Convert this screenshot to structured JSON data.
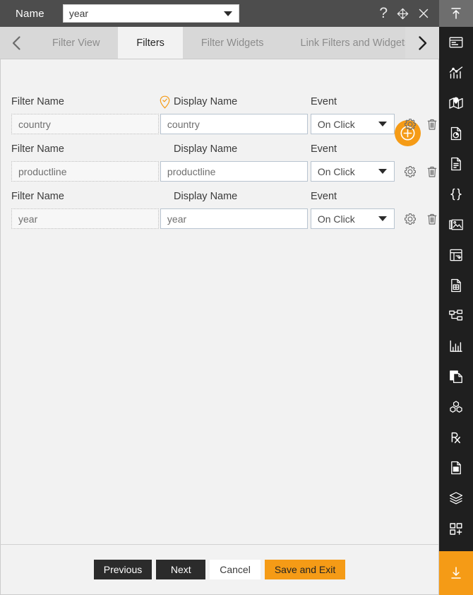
{
  "titlebar": {
    "name_label": "Name",
    "name_value": "year",
    "help_icon": "question-mark-icon",
    "move_icon": "move-icon",
    "close_icon": "close-icon"
  },
  "tabs": {
    "prev_arrow_icon": "chevron-left-icon",
    "next_arrow_icon": "chevron-right-icon",
    "items": [
      {
        "label": "Filter View",
        "active": false
      },
      {
        "label": "Filters",
        "active": true
      },
      {
        "label": "Filter Widgets",
        "active": false
      },
      {
        "label": "Link Filters and Widgets",
        "active": false
      }
    ]
  },
  "content": {
    "add_button_icon": "plus-circle-icon",
    "columns": {
      "filter_name": "Filter Name",
      "display_name": "Display Name",
      "event": "Event"
    },
    "display_name_badge_icon": "map-pin-check-icon",
    "row_settings_icon": "gear-icon",
    "row_delete_icon": "trash-icon",
    "event_caret_icon": "chevron-down-icon",
    "rows": [
      {
        "filter_name": "country",
        "display_name": "country",
        "event": "On Click",
        "has_badge": true
      },
      {
        "filter_name": "productline",
        "display_name": "productline",
        "event": "On Click",
        "has_badge": false
      },
      {
        "filter_name": "year",
        "display_name": "year",
        "event": "On Click",
        "has_badge": false
      }
    ]
  },
  "footer": {
    "previous": "Previous",
    "next": "Next",
    "cancel": "Cancel",
    "save_and_exit": "Save and Exit"
  },
  "rail": {
    "items": [
      {
        "icon": "collapse-up-icon",
        "state": "active-top"
      },
      {
        "icon": "dashboard-icon",
        "state": "normal"
      },
      {
        "icon": "chart-icon",
        "state": "normal"
      },
      {
        "icon": "map-icon",
        "state": "normal"
      },
      {
        "icon": "report-pie-icon",
        "state": "normal"
      },
      {
        "icon": "document-icon",
        "state": "normal"
      },
      {
        "icon": "braces-icon",
        "state": "normal"
      },
      {
        "icon": "image-gallery-icon",
        "state": "normal"
      },
      {
        "icon": "table-refresh-icon",
        "state": "normal"
      },
      {
        "icon": "document-grid-icon",
        "state": "normal"
      },
      {
        "icon": "hierarchy-icon",
        "state": "normal"
      },
      {
        "icon": "bar-analytics-icon",
        "state": "normal"
      },
      {
        "icon": "copy-page-icon",
        "state": "normal"
      },
      {
        "icon": "cubes-icon",
        "state": "normal"
      },
      {
        "icon": "prescription-rx-icon",
        "state": "normal"
      },
      {
        "icon": "document-save-icon",
        "state": "normal"
      },
      {
        "icon": "layers-icon",
        "state": "normal"
      },
      {
        "icon": "add-widget-icon",
        "state": "normal"
      },
      {
        "icon": "download-icon",
        "state": "active-bottom"
      }
    ]
  },
  "colors": {
    "accent_orange": "#f59b16",
    "titlebar_gray": "#4d4d4d",
    "tabstrip_gray": "#d8d8d8",
    "content_gray": "#f2f2f2",
    "rail_dark": "#1f1f1f",
    "button_dark": "#2b2b2b"
  }
}
